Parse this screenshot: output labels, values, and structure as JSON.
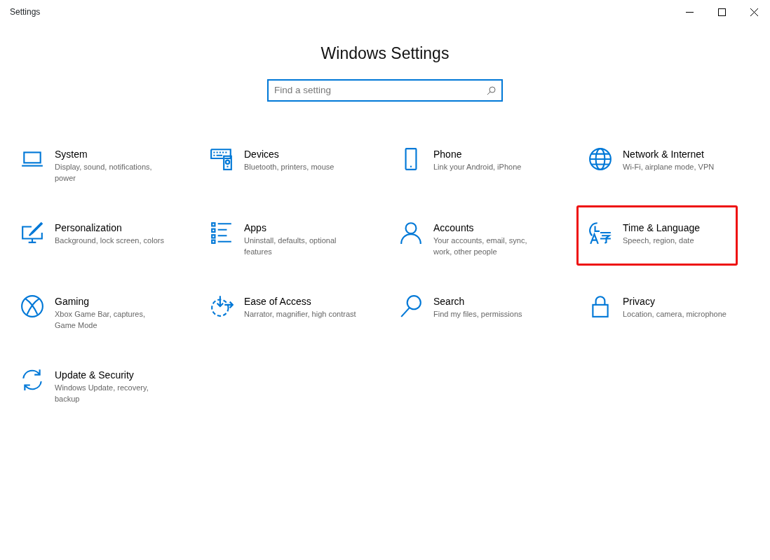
{
  "window": {
    "title": "Settings"
  },
  "heading": "Windows Settings",
  "search": {
    "placeholder": "Find a setting"
  },
  "categories": [
    {
      "kind": "laptop",
      "title": "System",
      "description": "Display, sound, notifications, power",
      "highlighted": false
    },
    {
      "kind": "keyboard",
      "title": "Devices",
      "description": "Bluetooth, printers, mouse",
      "highlighted": false
    },
    {
      "kind": "phone",
      "title": "Phone",
      "description": "Link your Android, iPhone",
      "highlighted": false
    },
    {
      "kind": "globe",
      "title": "Network & Internet",
      "description": "Wi-Fi, airplane mode, VPN",
      "highlighted": false
    },
    {
      "kind": "brush",
      "title": "Personalization",
      "description": "Background, lock screen, colors",
      "highlighted": false
    },
    {
      "kind": "list",
      "title": "Apps",
      "description": "Uninstall, defaults, optional features",
      "highlighted": false
    },
    {
      "kind": "person",
      "title": "Accounts",
      "description": "Your accounts, email, sync, work, other people",
      "highlighted": false
    },
    {
      "kind": "clock",
      "title": "Time & Language",
      "description": "Speech, region, date",
      "highlighted": true
    },
    {
      "kind": "xbox",
      "title": "Gaming",
      "description": "Xbox Game Bar, captures, Game Mode",
      "highlighted": false
    },
    {
      "kind": "dial",
      "title": "Ease of Access",
      "description": "Narrator, magnifier, high contrast",
      "highlighted": false
    },
    {
      "kind": "search",
      "title": "Search",
      "description": "Find my files, permissions",
      "highlighted": false
    },
    {
      "kind": "lock",
      "title": "Privacy",
      "description": "Location, camera, microphone",
      "highlighted": false
    },
    {
      "kind": "sync",
      "title": "Update & Security",
      "description": "Windows Update, recovery, backup",
      "highlighted": false
    }
  ]
}
